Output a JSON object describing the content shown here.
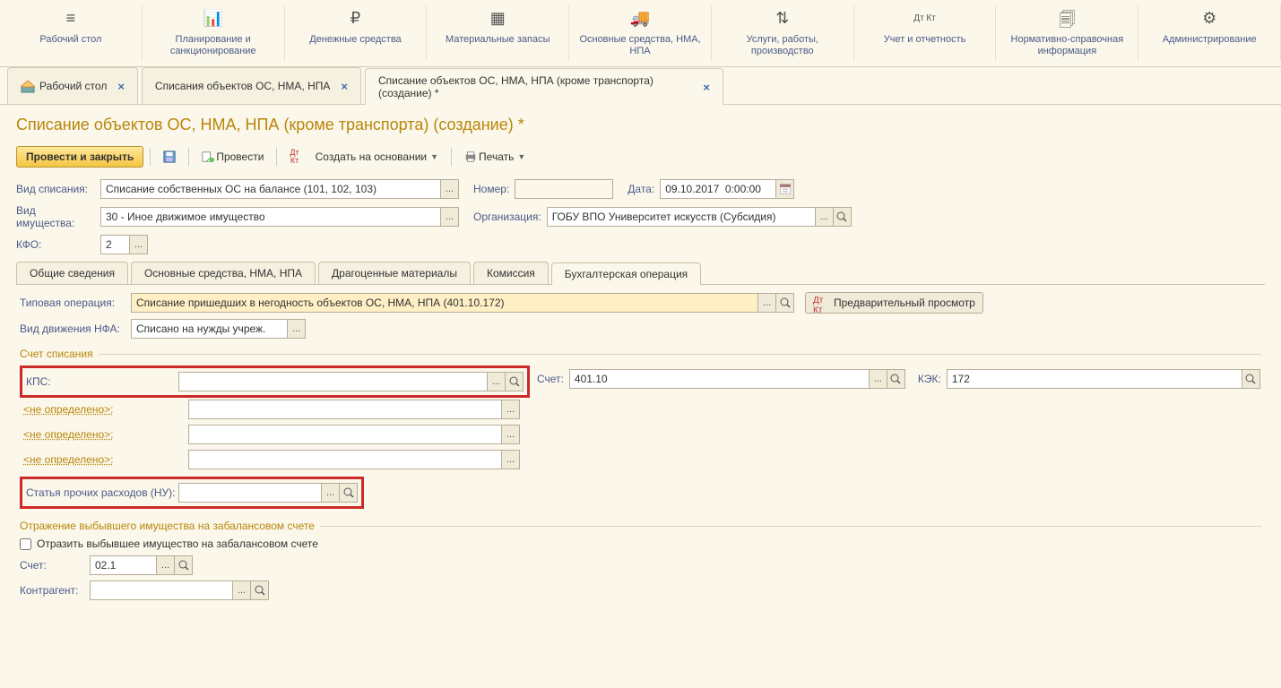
{
  "topNav": [
    {
      "icon": "≡",
      "label": "Рабочий стол"
    },
    {
      "icon": "📊",
      "label": "Планирование и санкционирование"
    },
    {
      "icon": "₽",
      "label": "Денежные средства"
    },
    {
      "icon": "▦",
      "label": "Материальные запасы"
    },
    {
      "icon": "🚚",
      "label": "Основные средства, НМА, НПА"
    },
    {
      "icon": "⇅",
      "label": "Услуги, работы, производство"
    },
    {
      "icon": "Дт Кт",
      "label": "Учет и отчетность"
    },
    {
      "icon": "🗐",
      "label": "Нормативно-справочная информация"
    },
    {
      "icon": "⚙",
      "label": "Администрирование"
    }
  ],
  "tabs": [
    {
      "label": "Рабочий стол",
      "closable": true,
      "icon": true
    },
    {
      "label": "Списания объектов ОС, НМА, НПА",
      "closable": true
    },
    {
      "label": "Списание объектов ОС, НМА, НПА (кроме транспорта) (создание) *",
      "closable": true,
      "active": true
    }
  ],
  "pageTitle": "Списание объектов ОС, НМА, НПА (кроме транспорта) (создание) *",
  "toolbar": {
    "primary": "Провести и закрыть",
    "post": "Провести",
    "createBased": "Создать на основании",
    "print": "Печать"
  },
  "header": {
    "vidSpisania": {
      "label": "Вид списания:",
      "value": "Списание собственных ОС на балансе (101, 102, 103)"
    },
    "nomer": {
      "label": "Номер:"
    },
    "data": {
      "label": "Дата:",
      "value": "09.10.2017  0:00:00"
    },
    "vidImush": {
      "label": "Вид имущества:",
      "value": "30 - Иное движимое имущество"
    },
    "org": {
      "label": "Организация:",
      "value": "ГОБУ ВПО Университет искусств (Субсидия)"
    },
    "kfo": {
      "label": "КФО:",
      "value": "2"
    }
  },
  "subtabs": [
    "Общие сведения",
    "Основные средства, НМА, НПА",
    "Драгоценные материалы",
    "Комиссия",
    "Бухгалтерская операция"
  ],
  "activeSubtab": 4,
  "op": {
    "tipOp": {
      "label": "Типовая операция:",
      "value": "Списание пришедших в негодность объектов ОС, НМА, НПА (401.10.172)"
    },
    "preview": "Предварительный просмотр",
    "vidDvizh": {
      "label": "Вид движения НФА:",
      "value": "Списано на нужды учреж."
    }
  },
  "schet": {
    "legend": "Счет списания",
    "kps": "КПС:",
    "schetLabel": "Счет:",
    "schetVal": "401.10",
    "kek": "КЭК:",
    "kekVal": "172",
    "notDefined": "<не определено>:",
    "statya": "Статья прочих расходов (НУ):"
  },
  "zabalans": {
    "legend": "Отражение выбывшего имущества на забалансовом счете",
    "checkbox": "Отразить выбывшее имущество на забалансовом счете",
    "schet": "Счет:",
    "schetVal": "02.1",
    "kontragent": "Контрагент:"
  }
}
